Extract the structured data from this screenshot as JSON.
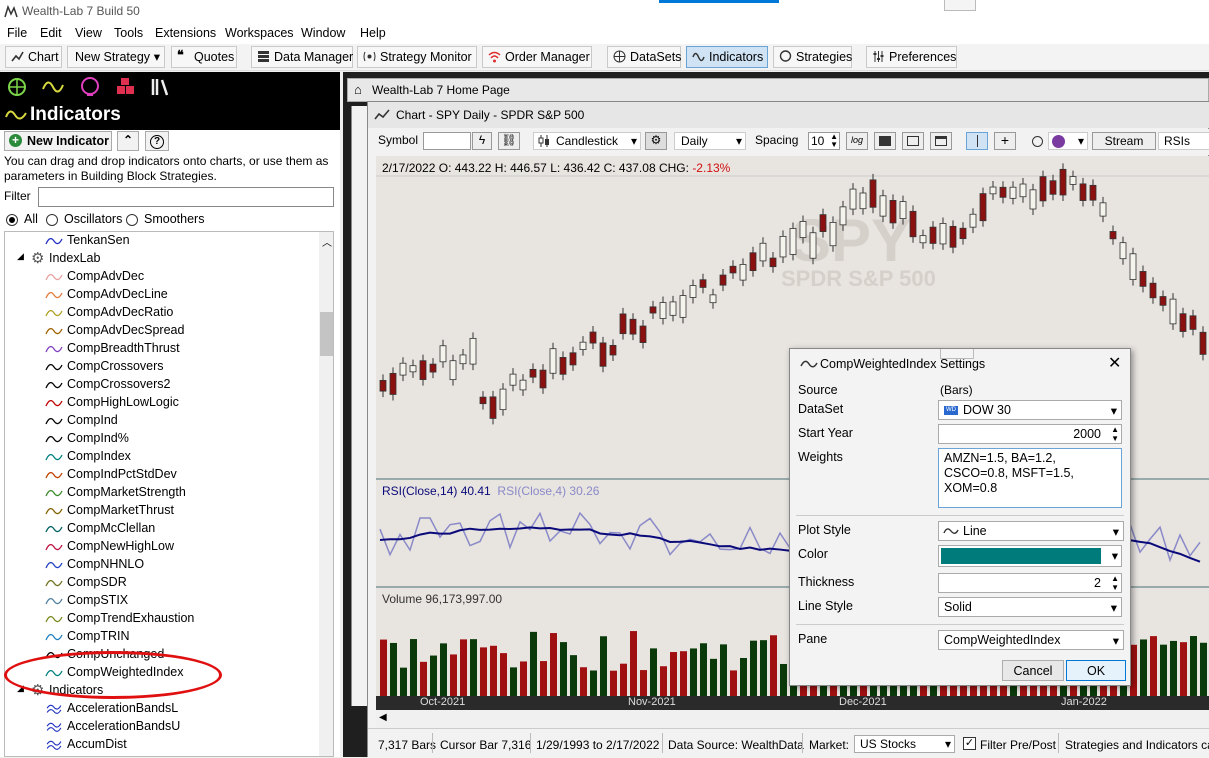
{
  "app": {
    "title": "Wealth-Lab 7 Build 50"
  },
  "menu": [
    "File",
    "Edit",
    "View",
    "Tools",
    "Extensions",
    "Workspaces",
    "Window",
    "Help"
  ],
  "toolbar": {
    "chart": "Chart",
    "new_strategy": "New Strategy",
    "quotes": "Quotes",
    "data_manager": "Data Manager",
    "strategy_monitor": "Strategy Monitor",
    "order_manager": "Order Manager",
    "datasets": "DataSets",
    "indicators": "Indicators",
    "strategies": "Strategies",
    "preferences": "Preferences"
  },
  "left": {
    "title": "Indicators",
    "new_indicator": "New Indicator",
    "description": "You can drag and drop indicators onto charts, or use them as parameters in Building Block Strategies.",
    "filter_label": "Filter",
    "filter_value": "",
    "radios": {
      "all": "All",
      "osc": "Oscillators",
      "smooth": "Smoothers"
    },
    "tree_top": "TenkanSen",
    "group1": "IndexLab",
    "items": [
      "CompAdvDec",
      "CompAdvDecLine",
      "CompAdvDecRatio",
      "CompAdvDecSpread",
      "CompBreadthThrust",
      "CompCrossovers",
      "CompCrossovers2",
      "CompHighLowLogic",
      "CompInd",
      "CompInd%",
      "CompIndex",
      "CompIndPctStdDev",
      "CompMarketStrength",
      "CompMarketThrust",
      "CompMcClellan",
      "CompNewHighLow",
      "CompNHNLO",
      "CompSDR",
      "CompSTIX",
      "CompTrendExhaustion",
      "CompTRIN",
      "CompUnchanged",
      "CompWeightedIndex"
    ],
    "item_colors": [
      "#e8a0a0",
      "#e07a3a",
      "#b0a020",
      "#a06000",
      "#8040c0",
      "#000000",
      "#000000",
      "#c00000",
      "#000000",
      "#000000",
      "#008080",
      "#c04000",
      "#3a8a2a",
      "#806000",
      "#006060",
      "#c01040",
      "#2040c0",
      "#707020",
      "#5080a0",
      "#7a8a20",
      "#2080c0",
      "#000000",
      "#008080"
    ],
    "group2": "Indicators",
    "items2": [
      "AccelerationBandsL",
      "AccelerationBandsU",
      "AccumDist"
    ]
  },
  "home_tab": "Wealth-Lab 7 Home Page",
  "chart": {
    "window_title": "Chart - SPY Daily - SPDR S&P 500",
    "symbol_label": "Symbol",
    "chart_style": "Candlestick",
    "scale": "Daily",
    "spacing_label": "Spacing",
    "spacing": "10",
    "log_label": "log",
    "stream": "Stream",
    "rsis": "RSIs",
    "info": {
      "date": "2/17/2022",
      "o": "O: 443.22",
      "h": "H: 446.57",
      "l": "L: 436.42",
      "c": "C: 437.08",
      "chg_label": "CHG:",
      "chg": "-2.13%"
    },
    "watermark_sym": "SPY",
    "watermark_name": "SPDR S&P 500",
    "rsi14": "RSI(Close,14) 40.41",
    "rsi4": "RSI(Close,4) 30.26",
    "volume": "Volume 96,173,997.00",
    "xaxis": [
      "Oct-2021",
      "Nov-2021",
      "Dec-2021",
      "Jan-2022"
    ]
  },
  "status": {
    "bars": "7,317 Bars",
    "cursor": "Cursor Bar 7,316",
    "range": "1/29/1993 to 2/17/2022",
    "source": "Data Source: WealthData",
    "market_label": "Market:",
    "market": "US Stocks",
    "filter": "Filter Pre/Post",
    "strat": "Strategies and Indicators ca"
  },
  "dialog": {
    "title": "CompWeightedIndex Settings",
    "source_label": "Source",
    "source": "(Bars)",
    "dataset_label": "DataSet",
    "dataset": "DOW 30",
    "start_label": "Start Year",
    "start": "2000",
    "weights_label": "Weights",
    "weights": "AMZN=1.5, BA=1.2, CSCO=0.8, MSFT=1.5, XOM=0.8",
    "plot_label": "Plot Style",
    "plot": "Line",
    "color_label": "Color",
    "color": "#007b7b",
    "thick_label": "Thickness",
    "thick": "2",
    "linestyle_label": "Line Style",
    "linestyle": "Solid",
    "pane_label": "Pane",
    "pane": "CompWeightedIndex",
    "cancel": "Cancel",
    "ok": "OK"
  },
  "colors": {
    "up_fill": "#f4f4ec",
    "down_fill": "#8b1010",
    "rsi14": "#0a0a7a",
    "rsi4": "#8a8ac8",
    "vol_up": "#0a3a0a",
    "vol_down": "#a01010",
    "accent": "#0078d7"
  }
}
